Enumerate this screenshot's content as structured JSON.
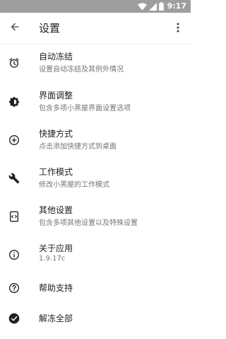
{
  "status_bar": {
    "time": "9:17",
    "icons": [
      "wifi-icon",
      "signal-icon",
      "battery-icon"
    ]
  },
  "app_bar": {
    "title": "设置",
    "back_icon": "arrow-back-icon",
    "menu_icon": "more-vert-icon"
  },
  "settings": {
    "items": [
      {
        "icon": "alarm-icon",
        "title": "自动冻结",
        "subtitle": "设置自动冻结及其例外情况"
      },
      {
        "icon": "brightness-icon",
        "title": "界面调整",
        "subtitle": "包含多项小黑屋界面设置选项"
      },
      {
        "icon": "add-circle-icon",
        "title": "快捷方式",
        "subtitle": "点击添加快捷方式到桌面"
      },
      {
        "icon": "wrench-icon",
        "title": "工作模式",
        "subtitle": "修改小黑屋的工作模式"
      },
      {
        "icon": "settings-ethernet-icon",
        "title": "其他设置",
        "subtitle": "包含多项其他设置以及特殊设置"
      },
      {
        "icon": "info-icon",
        "title": "关于应用",
        "subtitle": "1.9.17c"
      },
      {
        "icon": "help-icon",
        "title": "帮助支持",
        "subtitle": ""
      },
      {
        "icon": "check-circle-icon",
        "title": "解冻全部",
        "subtitle": ""
      }
    ]
  },
  "colors": {
    "status_bar": "#9e9e9e",
    "text_primary": "#212121",
    "text_secondary": "#757575",
    "icon": "#212121"
  }
}
